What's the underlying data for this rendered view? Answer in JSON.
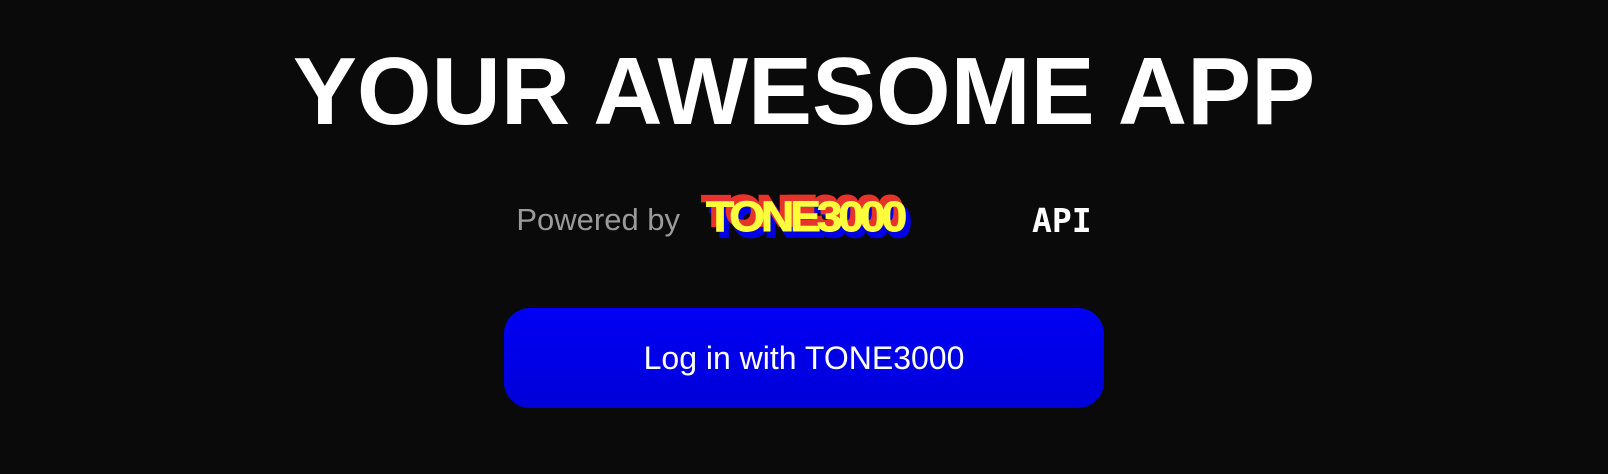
{
  "title": "YOUR AWESOME APP",
  "powered": {
    "prefix": "Powered by",
    "logo_text": "TONE3000",
    "suffix": "API"
  },
  "login_button": {
    "label": "Log in with TONE3000"
  },
  "colors": {
    "background": "#0a0a0a",
    "button": "#0000f0",
    "logo_red": "#e8332a",
    "logo_yellow": "#ffff3c",
    "logo_blue": "#0000e6"
  }
}
